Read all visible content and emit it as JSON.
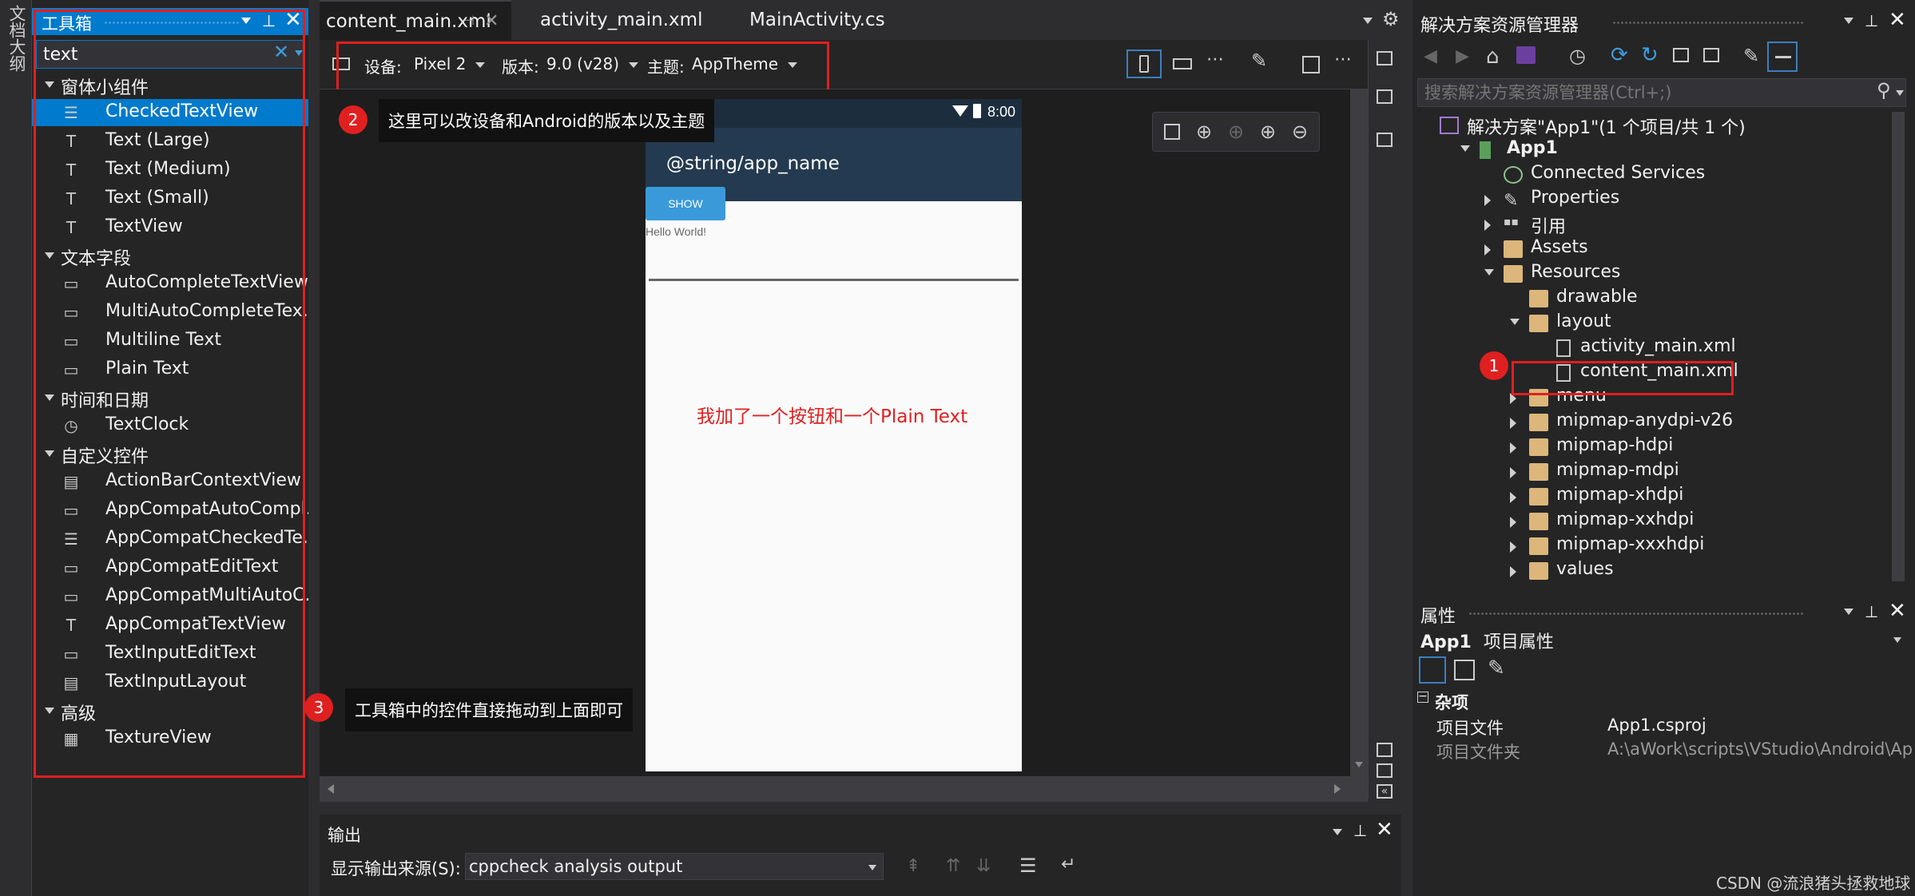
{
  "left_strip": {
    "label": "文档大纲"
  },
  "toolbox": {
    "title": "工具箱",
    "search_value": "text",
    "categories": [
      {
        "name": "窗体小组件",
        "items": [
          "CheckedTextView",
          "Text (Large)",
          "Text (Medium)",
          "Text (Small)",
          "TextView"
        ]
      },
      {
        "name": "文本字段",
        "items": [
          "AutoCompleteTextView",
          "MultiAutoCompleteTex...",
          "Multiline Text",
          "Plain Text"
        ]
      },
      {
        "name": "时间和日期",
        "items": [
          "TextClock"
        ]
      },
      {
        "name": "自定义控件",
        "items": [
          "ActionBarContextView",
          "AppCompatAutoCompl...",
          "AppCompatCheckedTe...",
          "AppCompatEditText",
          "AppCompatMultiAutoC...",
          "AppCompatTextView",
          "TextInputEditText",
          "TextInputLayout"
        ]
      },
      {
        "name": "高级",
        "items": [
          "TextureView"
        ]
      }
    ],
    "selected_item": "CheckedTextView"
  },
  "doc_tabs": [
    "content_main.xml",
    "activity_main.xml",
    "MainActivity.cs"
  ],
  "designer_toolbar": {
    "device_label": "设备:",
    "device_value": "Pixel 2",
    "version_label": "版本:",
    "version_value": "9.0 (v28)",
    "theme_label": "主题:",
    "theme_value": "AppTheme"
  },
  "phone": {
    "time": "8:00",
    "app_title": "@string/app_name",
    "button_text": "SHOW",
    "hello_text": "Hello World!"
  },
  "annotations": {
    "n1": "1",
    "n2": "2",
    "n3": "3",
    "callout2": "这里可以改设备和Android的版本以及主题",
    "callout3": "工具箱中的控件直接拖动到上面即可",
    "canvas_note": "我加了一个按钮和一个Plain Text",
    "accent": "#e01f1f"
  },
  "solution_explorer": {
    "title": "解决方案资源管理器",
    "search_placeholder": "搜索解决方案资源管理器(Ctrl+;)",
    "nodes": [
      {
        "label": "解决方案\"App1\"(1 个项目/共 1 个)"
      },
      {
        "label": "App1"
      },
      {
        "label": "Connected Services"
      },
      {
        "label": "Properties"
      },
      {
        "label": "引用"
      },
      {
        "label": "Assets"
      },
      {
        "label": "Resources"
      },
      {
        "label": "drawable"
      },
      {
        "label": "layout"
      },
      {
        "label": "activity_main.xml"
      },
      {
        "label": "content_main.xml"
      },
      {
        "label": "menu"
      },
      {
        "label": "mipmap-anydpi-v26"
      },
      {
        "label": "mipmap-hdpi"
      },
      {
        "label": "mipmap-mdpi"
      },
      {
        "label": "mipmap-xhdpi"
      },
      {
        "label": "mipmap-xxhdpi"
      },
      {
        "label": "mipmap-xxxhdpi"
      },
      {
        "label": "values"
      }
    ]
  },
  "properties": {
    "title": "属性",
    "object": "App1",
    "object_type": "项目属性",
    "section": "杂项",
    "rows": [
      {
        "key": "项目文件",
        "value": "App1.csproj"
      },
      {
        "key": "项目文件夹",
        "value": "A:\\aWork\\scripts\\VStudio\\Android\\Ap"
      }
    ]
  },
  "output": {
    "title": "输出",
    "source_label": "显示输出来源(S):",
    "source_value": "cppcheck analysis output"
  },
  "watermark": "CSDN @流浪猪头拯救地球"
}
